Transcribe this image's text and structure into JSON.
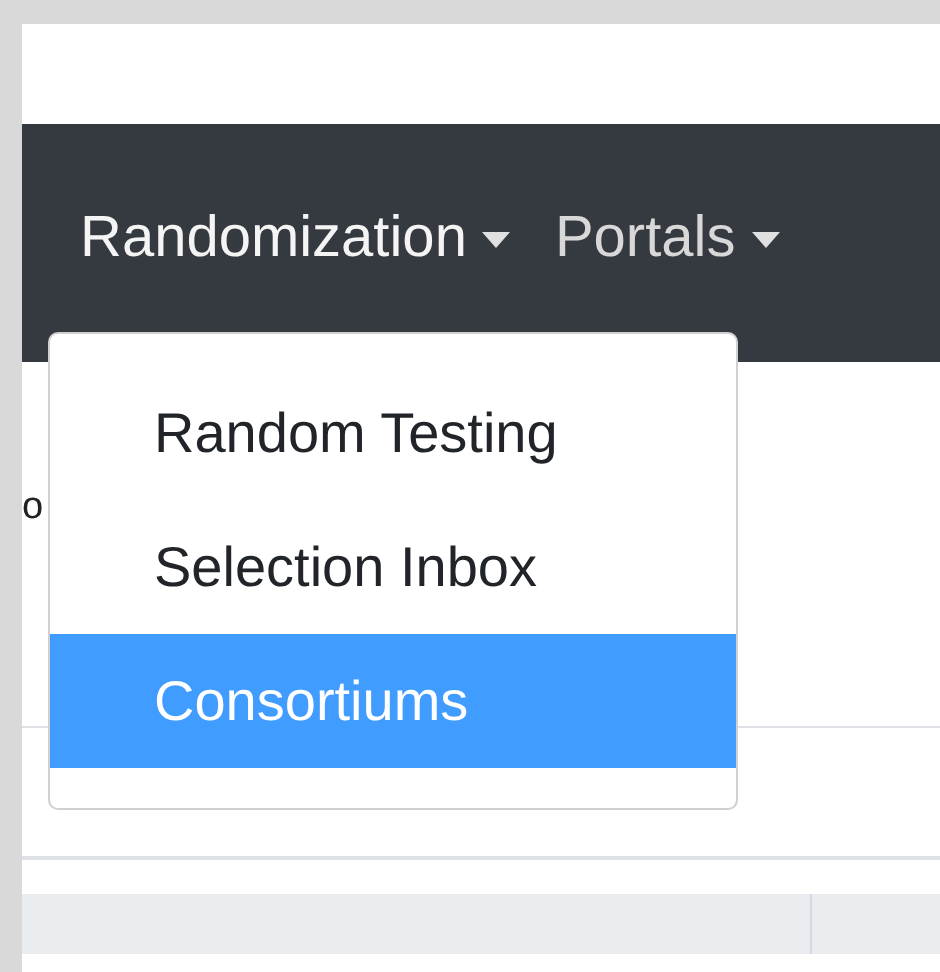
{
  "navbar": {
    "items": [
      {
        "label": "Randomization",
        "expanded": true
      },
      {
        "label": "Portals",
        "expanded": false
      }
    ]
  },
  "dropdown": {
    "items": [
      {
        "label": "Random Testing",
        "selected": false
      },
      {
        "label": "Selection Inbox",
        "selected": false
      },
      {
        "label": "Consortiums",
        "selected": true
      }
    ]
  },
  "page": {
    "partial_text": "o"
  }
}
